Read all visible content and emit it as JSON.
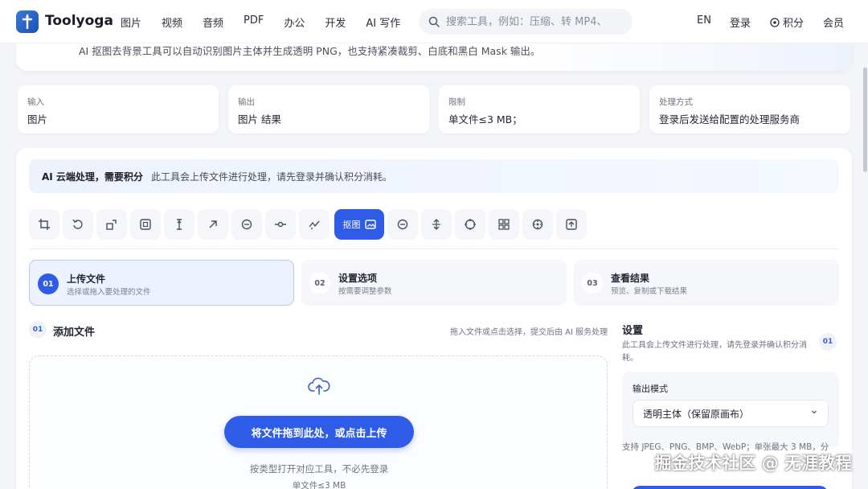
{
  "header": {
    "logo_text": "Toolyoga",
    "nav": [
      "图片",
      "视频",
      "音频",
      "PDF",
      "办公",
      "开发",
      "AI 写作"
    ],
    "search_placeholder": "搜索工具，例如：压缩、转 MP4、",
    "lang": "EN",
    "login": "登录",
    "points": "积分",
    "member": "会员"
  },
  "intro": {
    "text": "AI 抠图去背景工具可以自动识别图片主体并生成透明 PNG，也支持紧凑裁剪、白底和黑白 Mask 输出。"
  },
  "info_cards": [
    {
      "label": "输入",
      "value": "图片"
    },
    {
      "label": "输出",
      "value": "图片 结果"
    },
    {
      "label": "限制",
      "value": "单文件≤3 MB；"
    },
    {
      "label": "处理方式",
      "value": "登录后发送给配置的处理服务商"
    }
  ],
  "notice": {
    "bold": "AI 云端处理，需要积分",
    "text": "此工具会上传文件进行处理，请先登录并确认积分消耗。"
  },
  "toolbar": {
    "active_label": "抠图",
    "icons": [
      "crop-icon",
      "rotate-icon",
      "resize-icon",
      "frame-icon",
      "text-height-icon",
      "arrow-up-right-icon",
      "minus-circle-icon",
      "node-icon",
      "curve-icon",
      "cutout-icon",
      "minus-circle-icon",
      "vertical-arrows-icon",
      "target-icon",
      "grid-icon",
      "crosshair-icon",
      "plus-square-icon"
    ]
  },
  "steps": [
    {
      "num": "01",
      "title": "上传文件",
      "sub": "选择或拖入要处理的文件"
    },
    {
      "num": "02",
      "title": "设置选项",
      "sub": "按需要调整参数"
    },
    {
      "num": "03",
      "title": "查看结果",
      "sub": "预览、复制或下载结果"
    }
  ],
  "upload": {
    "badge": "01",
    "title": "添加文件",
    "note": "拖入文件或点击选择，提交后由 AI 服务处理",
    "button": "将文件拖到此处，或点击上传",
    "hint": "按类型打开对应工具，不必先登录",
    "limit": "单文件≤3 MB"
  },
  "settings": {
    "title": "设置",
    "badge": "01",
    "desc": "此工具会上传文件进行处理，请先登录并确认积分消耗。",
    "mode_label": "输出模式",
    "mode_value": "透明主体（保留原画布）",
    "support": "支持 JPEG、PNG、BMP、WebP；单张最大 3 MB，分"
  },
  "watermark": "掘金技术社区 @ 无涯教程",
  "colors": {
    "accent": "#2f5ce6",
    "background": "#f3f5f9"
  }
}
